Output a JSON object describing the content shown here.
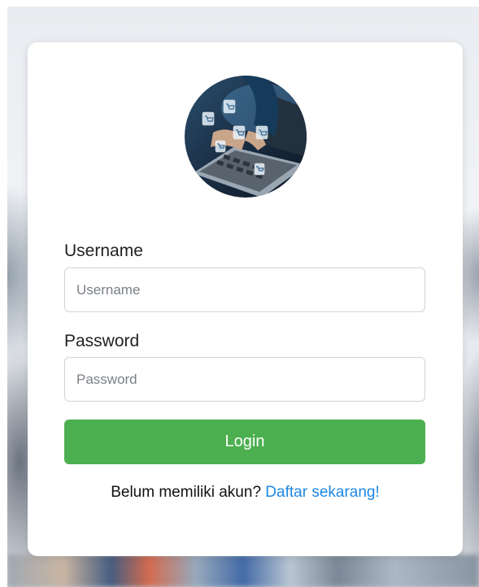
{
  "login_form": {
    "avatar_icon": "online-shopping-laptop-image",
    "username": {
      "label": "Username",
      "placeholder": "Username",
      "value": ""
    },
    "password": {
      "label": "Password",
      "placeholder": "Password",
      "value": ""
    },
    "submit_label": "Login",
    "signup_prompt": "Belum memiliki akun?",
    "signup_link": "Daftar sekarang!"
  },
  "colors": {
    "button_bg": "#4caf50",
    "link": "#1e88e5"
  }
}
